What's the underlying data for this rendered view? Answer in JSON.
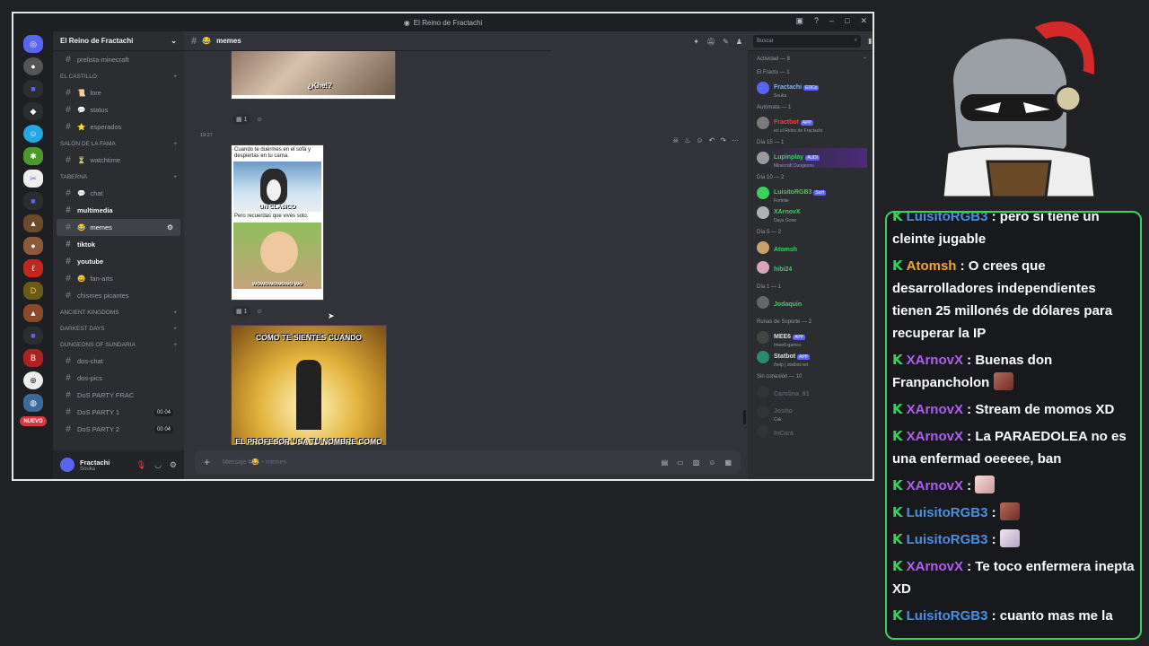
{
  "window": {
    "title": "El Reino de Fractachi"
  },
  "server": {
    "name": "El Reino de Fractachi"
  },
  "guilds": {
    "new_label": "NUEVO"
  },
  "channels": [
    {
      "type": "chan",
      "name": "prelista-minecraft",
      "style": "dim"
    },
    {
      "type": "cat",
      "name": "EL CASTILLO"
    },
    {
      "type": "chan",
      "name": "lore",
      "emoji": "📜"
    },
    {
      "type": "chan",
      "name": "status",
      "emoji": "💬"
    },
    {
      "type": "chan",
      "name": "esperados",
      "emoji": "⭐"
    },
    {
      "type": "cat",
      "name": "SALÓN DE LA FAMA"
    },
    {
      "type": "chan",
      "name": "watchtime",
      "emoji": "⏳"
    },
    {
      "type": "cat",
      "name": "TABERNA"
    },
    {
      "type": "chan",
      "name": "chat",
      "emoji": "💬"
    },
    {
      "type": "chan",
      "name": "multimedia",
      "style": "bold"
    },
    {
      "type": "chan",
      "name": "memes",
      "emoji": "😂",
      "style": "active"
    },
    {
      "type": "chan",
      "name": "tiktok",
      "style": "bold"
    },
    {
      "type": "chan",
      "name": "youtube",
      "style": "bold"
    },
    {
      "type": "chan",
      "name": "fan-arts",
      "emoji": "😀"
    },
    {
      "type": "chan",
      "name": "chismes picantes"
    },
    {
      "type": "cat",
      "name": "ANCIENT KINGDOMS"
    },
    {
      "type": "cat",
      "name": "DARKEST DAYS"
    },
    {
      "type": "cat",
      "name": "DUNGEONS OF SUNDARIA"
    },
    {
      "type": "chan",
      "name": "dos-chat"
    },
    {
      "type": "chan",
      "name": "dos-pics"
    },
    {
      "type": "chan",
      "name": "DoS PARTY FRAC"
    },
    {
      "type": "chan",
      "name": "DoS PARTY 1",
      "badge": "00 04"
    },
    {
      "type": "chan",
      "name": "DoS PARTY 2",
      "badge": "00 04"
    }
  ],
  "user": {
    "name": "Fractachi",
    "status": "Souka"
  },
  "channel_header": {
    "name": "memes",
    "emoji": "😂"
  },
  "search": {
    "placeholder": "Buscar"
  },
  "messages": {
    "reaction_count_1": "1",
    "reaction_count_2": "1",
    "timestamp": "19:27",
    "meme1_caption": "¿Khe!?",
    "meme2_text1": "Cuando te duermes en el sofá y despiertas en tu cama.",
    "meme2_label1": "UN CLASICO",
    "meme2_text2": "Pero recuerdas que vives solo.",
    "meme2_label2": "wowowowowo wo",
    "meme3_top": "COMO TE SIENTES CUANDO",
    "meme3_bottom": "EL PROFESOR USA TU NOMBRE COMO EJEMPLO."
  },
  "composer": {
    "placeholder": "Mensaje #😂・memes"
  },
  "members": {
    "header": "Actividad — 8",
    "groups": [
      {
        "title": "El Fracto — 1",
        "items": [
          {
            "name": "Fractachi",
            "sub": "Souka",
            "tag": "EDCo",
            "color": "#79b8ff",
            "avatar": "#5865f2"
          }
        ]
      },
      {
        "title": "Autómata — 1",
        "items": [
          {
            "name": "Fractbot",
            "sub": "en el Reino de Fractachi",
            "tag": "APP",
            "color": "#f23f43",
            "avatar": "#7a7a7a"
          }
        ]
      },
      {
        "title": "Día 15 — 1",
        "items": [
          {
            "name": "Lupinplay",
            "sub": "Minecraft Dungeons",
            "tag": "AUDI",
            "color": "#3ad25c",
            "avatar": "#9a9a9a",
            "highlight": true
          }
        ]
      },
      {
        "title": "Día 10 — 2",
        "items": [
          {
            "name": "LuisitoRGB3",
            "sub": "Fortnite",
            "tag": "SoH",
            "color": "#3ad25c",
            "avatar": "#3ad25c"
          },
          {
            "name": "XArnovX",
            "sub": "Days Gone",
            "color": "#3ad25c",
            "avatar": "#b0b0b0"
          }
        ]
      },
      {
        "title": "Día 5 — 2",
        "items": [
          {
            "name": "Atomsh",
            "sub": "",
            "color": "#3ad25c",
            "avatar": "#c9a16a"
          },
          {
            "name": "hibi24",
            "sub": "",
            "color": "#3ad25c",
            "avatar": "#d9a3b8"
          }
        ]
      },
      {
        "title": "Día 1 — 1",
        "items": [
          {
            "name": "Jodaquin",
            "sub": "",
            "color": "#3ad25c",
            "avatar": "#666"
          }
        ]
      },
      {
        "title": "Runas de Soporte — 2",
        "items": [
          {
            "name": "MEE6",
            "sub": "/mee6-games",
            "tag": "APP",
            "color": "#dbdee1",
            "avatar": "#444"
          },
          {
            "name": "Statbot",
            "sub": "/help | statbot.net",
            "tag": "APP",
            "color": "#dbdee1",
            "avatar": "#2a8a6a"
          }
        ]
      },
      {
        "title": "Sin conexión — 10",
        "items": [
          {
            "name": "Carolina_91",
            "sub": "",
            "color": "#5c5f66",
            "avatar": "#333",
            "off": true
          },
          {
            "name": "Josito",
            "sub": "Csk",
            "color": "#5c5f66",
            "avatar": "#333",
            "off": true
          },
          {
            "name": "InCara",
            "sub": "",
            "color": "#5c5f66",
            "avatar": "#333",
            "off": true
          }
        ]
      }
    ]
  },
  "stream_chat": [
    {
      "user": "LuisitoRGB3",
      "color": "#4a90e2",
      "text": " : pero si tiene un cleinte jugable",
      "first": true
    },
    {
      "user": "Atomsh",
      "color": "#f5a623",
      "text": " : O crees que desarrolladores independientes tienen 25 millonés de dólares para recuperar la IP"
    },
    {
      "user": "XArnovX",
      "color": "#b15cf2",
      "text": " : Buenas don Franpancholon",
      "emote": "brown"
    },
    {
      "user": "XArnovX",
      "color": "#b15cf2",
      "text": " : Stream de momos XD"
    },
    {
      "user": "XArnovX",
      "color": "#b15cf2",
      "text": " : La PARAEDOLEA no es una enfermad oeeeee, ban"
    },
    {
      "user": "XArnovX",
      "color": "#b15cf2",
      "text": " : ",
      "emote": "pink"
    },
    {
      "user": "LuisitoRGB3",
      "color": "#4a90e2",
      "text": " : ",
      "emote": "brown"
    },
    {
      "user": "LuisitoRGB3",
      "color": "#4a90e2",
      "text": " : ",
      "emote": "anime"
    },
    {
      "user": "XArnovX",
      "color": "#b15cf2",
      "text": " : Te toco enfermera inepta XD"
    },
    {
      "user": "LuisitoRGB3",
      "color": "#4a90e2",
      "text": " : cuanto mas me la"
    }
  ],
  "colors": {
    "accent": "#5865f2",
    "chat_border": "#3ad25c",
    "kick_icon": "#3ad25c"
  }
}
